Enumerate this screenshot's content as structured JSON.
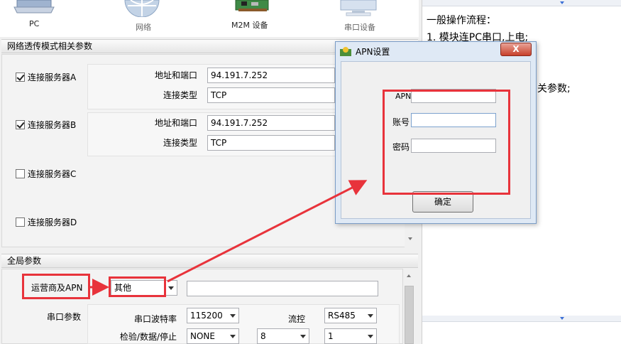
{
  "devices": [
    {
      "label": "PC",
      "icon": "laptop-icon"
    },
    {
      "label": "网络",
      "icon": "globe-icon"
    },
    {
      "label": "M2M 设备",
      "icon": "circuit-board-icon"
    },
    {
      "label": "串口设备",
      "icon": "monitor-icon"
    }
  ],
  "network_section": {
    "title": "网络透传模式相关参数",
    "servers": [
      {
        "label": "连接服务器A",
        "checked": true,
        "address_label": "地址和端口",
        "address": "94.191.7.252",
        "type_label": "连接类型",
        "type": "TCP"
      },
      {
        "label": "连接服务器B",
        "checked": true,
        "address_label": "地址和端口",
        "address": "94.191.7.252",
        "type_label": "连接类型",
        "type": "TCP"
      },
      {
        "label": "连接服务器C",
        "checked": false
      },
      {
        "label": "连接服务器D",
        "checked": false
      }
    ]
  },
  "global_section": {
    "title": "全局参数",
    "apn_label": "运营商及APN",
    "apn_select": "其他",
    "apn_text": "",
    "serial_label": "串口参数",
    "baud_label": "串口波特率",
    "baud_value": "115200",
    "flow_label": "流控",
    "flow_value": "RS485",
    "check_label": "检验/数据/停止",
    "parity_value": "NONE",
    "data_bits_value": "8",
    "stop_bits_value": "1"
  },
  "help": {
    "lines": [
      "一般操作流程：",
      "1. 模块连PC串口,上电;",
      "关参数;"
    ]
  },
  "dialog": {
    "title": "APN设置",
    "close_label": "X",
    "apn_label": "APN",
    "account_label": "账号",
    "password_label": "密码",
    "apn_value": "",
    "account_value": "",
    "password_value": "",
    "ok_label": "确定"
  },
  "colors": {
    "annotation_red": "#e8333b",
    "dialog_frame": "#dfe9f5",
    "close_button": "#c7402b"
  }
}
